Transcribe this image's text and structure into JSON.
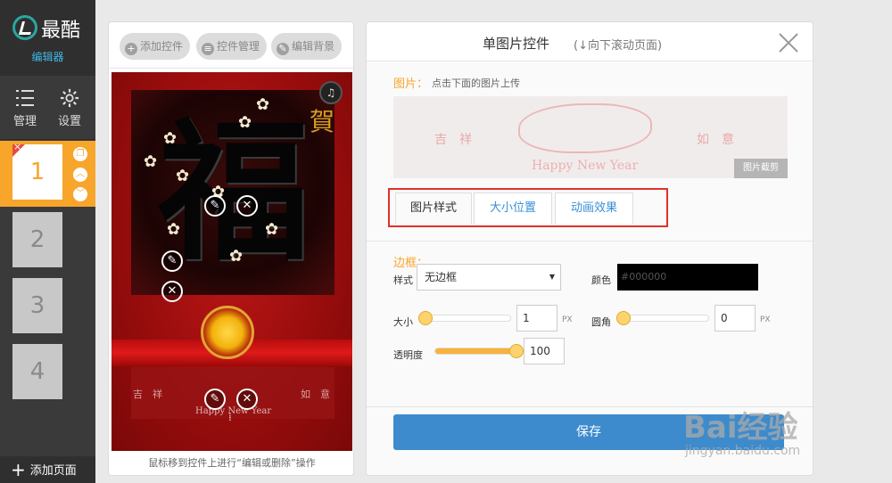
{
  "sidebar": {
    "logo_title": "最酷",
    "logo_subtitle": "编辑器",
    "nav": [
      {
        "label": "管理",
        "icon": "list-icon"
      },
      {
        "label": "设置",
        "icon": "gear-icon"
      }
    ],
    "pages": [
      "1",
      "2",
      "3",
      "4"
    ],
    "active_page": "1",
    "add_page_label": "添加页面"
  },
  "toolbar": {
    "add_control": "添加控件",
    "manage_control": "控件管理",
    "edit_background": "编辑背景"
  },
  "canvas": {
    "fu": "福",
    "he": "賀",
    "banner_left": "吉　祥",
    "banner_right": "如　意",
    "banner_happy": "Happy New Year",
    "hint": "鼠标移到控件上进行“编辑或删除”操作"
  },
  "panel": {
    "title": "单图片控件",
    "subtitle": "(↓向下滚动页面)",
    "image_label": "图片：",
    "image_hint": "点击下面的图片上传",
    "preview_left": "吉　祥",
    "preview_right": "如　意",
    "preview_happy": "Happy New Year",
    "crop_button": "图片截剪",
    "tabs": [
      "图片样式",
      "大小位置",
      "动画效果"
    ],
    "active_tab": "图片样式",
    "border_label": "边框：",
    "style_label": "样式",
    "style_value": "无边框",
    "color_label": "颜色",
    "color_value": "#000000",
    "size_label": "大小",
    "size_value": "1",
    "radius_label": "圆角",
    "radius_value": "0",
    "unit": "PX",
    "opacity_label": "透明度",
    "opacity_value": "100",
    "opacity_fraction": 1.0,
    "save_button": "保存"
  },
  "colors": {
    "accent": "#f7a52b",
    "save_blue": "#3d8bcc",
    "highlight_red": "#e0312c",
    "sidebar_bg": "#3a3a3a"
  },
  "watermark": {
    "text": "Bai经验",
    "url": "jingyan.baidu.com"
  }
}
